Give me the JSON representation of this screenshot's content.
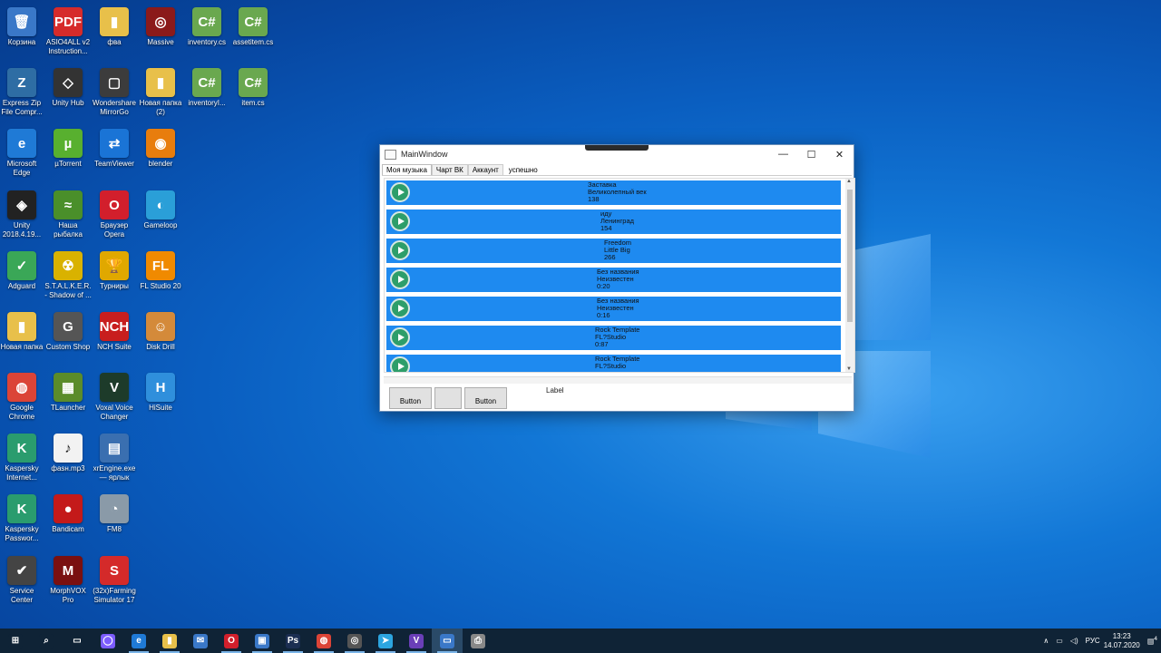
{
  "desktop": {
    "icons": [
      {
        "label": "Корзина",
        "glyph": "🗑",
        "color": "#3a78c8"
      },
      {
        "label": "ASIO4ALL v2 Instruction...",
        "glyph": "PDF",
        "color": "#d62b2b"
      },
      {
        "label": "фва",
        "glyph": "▮",
        "color": "#e8c04a"
      },
      {
        "label": "Massive",
        "glyph": "◎",
        "color": "#8b1a1a"
      },
      {
        "label": "inventory.cs",
        "glyph": "C#",
        "color": "#6aa84f"
      },
      {
        "label": "assetitem.cs",
        "glyph": "C#",
        "color": "#6aa84f"
      },
      {
        "label": "Express Zip File Compr...",
        "glyph": "Z",
        "color": "#2e6da4"
      },
      {
        "label": "Unity Hub",
        "glyph": "◇",
        "color": "#333333"
      },
      {
        "label": "Wondershare MirrorGo",
        "glyph": "▢",
        "color": "#3c3c3c"
      },
      {
        "label": "Новая папка (2)",
        "glyph": "▮",
        "color": "#e8c04a"
      },
      {
        "label": "inventoryI...",
        "glyph": "C#",
        "color": "#6aa84f"
      },
      {
        "label": "item.cs",
        "glyph": "C#",
        "color": "#6aa84f"
      },
      {
        "label": "Microsoft Edge",
        "glyph": "e",
        "color": "#1f7ad6"
      },
      {
        "label": "µTorrent",
        "glyph": "µ",
        "color": "#58b02f"
      },
      {
        "label": "TeamViewer",
        "glyph": "⇄",
        "color": "#1a74d6"
      },
      {
        "label": "blender",
        "glyph": "◉",
        "color": "#e87d0d"
      },
      {
        "label": "Unity 2018.4.19...",
        "glyph": "◈",
        "color": "#222222"
      },
      {
        "label": "Наша рыбалка",
        "glyph": "≈",
        "color": "#4a8f2a"
      },
      {
        "label": "Браузер Opera",
        "glyph": "O",
        "color": "#d21f2c"
      },
      {
        "label": "Gameloop",
        "glyph": "◐",
        "color": "#2a9fd8"
      },
      {
        "label": "Adguard",
        "glyph": "✓",
        "color": "#3aa757"
      },
      {
        "label": "S.T.A.L.K.E.R. - Shadow of ...",
        "glyph": "☢",
        "color": "#d9b200"
      },
      {
        "label": "Турниры",
        "glyph": "🏆",
        "color": "#e0a800"
      },
      {
        "label": "FL Studio 20",
        "glyph": "FL",
        "color": "#f08a00"
      },
      {
        "label": "Новая папка",
        "glyph": "▮",
        "color": "#e8c04a"
      },
      {
        "label": "Custom Shop",
        "glyph": "G",
        "color": "#555555"
      },
      {
        "label": "NCH Suite",
        "glyph": "NCH",
        "color": "#c81e1e"
      },
      {
        "label": "Disk Drill",
        "glyph": "☺",
        "color": "#d48a3a"
      },
      {
        "label": "Google Chrome",
        "glyph": "◍",
        "color": "#db4437"
      },
      {
        "label": "TLauncher",
        "glyph": "▦",
        "color": "#5b8c2a"
      },
      {
        "label": "Voxal Voice Changer",
        "glyph": "V",
        "color": "#1d3b2a"
      },
      {
        "label": "HiSuite",
        "glyph": "H",
        "color": "#2f8fdc"
      },
      {
        "label": "Kaspersky Internet...",
        "glyph": "K",
        "color": "#2a9c6e"
      },
      {
        "label": "фаsн.mp3",
        "glyph": "♪",
        "color": "#f2f2f2"
      },
      {
        "label": "xrEngine.exe — ярлык",
        "glyph": "▤",
        "color": "#3a6fb0"
      },
      {
        "label": "Kaspersky Passwor...",
        "glyph": "K",
        "color": "#2a9c6e"
      },
      {
        "label": "Bandicam",
        "glyph": "●",
        "color": "#c41a1a"
      },
      {
        "label": "FM8",
        "glyph": "◔",
        "color": "#8a9aa8"
      },
      {
        "label": "Service Center",
        "glyph": "✔",
        "color": "#444444"
      },
      {
        "label": "MorphVOX Pro",
        "glyph": "M",
        "color": "#7a1010"
      },
      {
        "label": "(32x)Farming Simulator 17",
        "glyph": "S",
        "color": "#d42a2a"
      }
    ]
  },
  "window": {
    "title": "MainWindow",
    "controls": {
      "minimize": "—",
      "maximize": "☐",
      "close": "✕"
    },
    "tabs": [
      "Моя музыка",
      "Чарт ВК",
      "Аккаунт"
    ],
    "status": "успешно",
    "tracks": [
      {
        "title": "Заставка",
        "artist": "Великолепный век",
        "duration": "138"
      },
      {
        "title": "иду",
        "artist": "Ленинград",
        "duration": "154"
      },
      {
        "title": "Freedom",
        "artist": "Little Big",
        "duration": "266"
      },
      {
        "title": "Без названия",
        "artist": "Неизвестен",
        "duration": "0:20"
      },
      {
        "title": "Без названия",
        "artist": "Неизвестен",
        "duration": "0:16"
      },
      {
        "title": "Rock Template",
        "artist": "FL?Studio",
        "duration": "0:87"
      },
      {
        "title": "Rock Template",
        "artist": "FL?Studio",
        "duration": ""
      }
    ],
    "buttons": [
      "Button",
      "",
      "Button"
    ],
    "label": "Label"
  },
  "taskbar": {
    "items": [
      {
        "name": "start-button",
        "glyph": "⊞",
        "color": "#0f2336"
      },
      {
        "name": "search-button",
        "glyph": "⌕",
        "color": "#0f2336"
      },
      {
        "name": "task-view-button",
        "glyph": "▭",
        "color": "#0f2336"
      },
      {
        "name": "cortana-button",
        "glyph": "◯",
        "color": "#7b5cff"
      },
      {
        "name": "edge-button",
        "glyph": "e",
        "color": "#1f7ad6"
      },
      {
        "name": "explorer-button",
        "glyph": "▮",
        "color": "#e8c04a"
      },
      {
        "name": "mail-button",
        "glyph": "✉",
        "color": "#3a78c8"
      },
      {
        "name": "opera-button",
        "glyph": "O",
        "color": "#d21f2c"
      },
      {
        "name": "store-button",
        "glyph": "▣",
        "color": "#3a78c8"
      },
      {
        "name": "photoshop-button",
        "glyph": "Ps",
        "color": "#1b2e52"
      },
      {
        "name": "chrome-button",
        "glyph": "◍",
        "color": "#db4437"
      },
      {
        "name": "media-button",
        "glyph": "◎",
        "color": "#555555"
      },
      {
        "name": "telegram-button",
        "glyph": "➤",
        "color": "#2ca5e0"
      },
      {
        "name": "visual-studio-button",
        "glyph": "V",
        "color": "#6a3fb8"
      },
      {
        "name": "app-window-button",
        "glyph": "▭",
        "color": "#3a78c8"
      },
      {
        "name": "printer-button",
        "glyph": "⎙",
        "color": "#888888"
      }
    ],
    "tray": {
      "language": "РУС",
      "time": "13:23",
      "date": "14.07.2020",
      "notifications": "4"
    }
  }
}
